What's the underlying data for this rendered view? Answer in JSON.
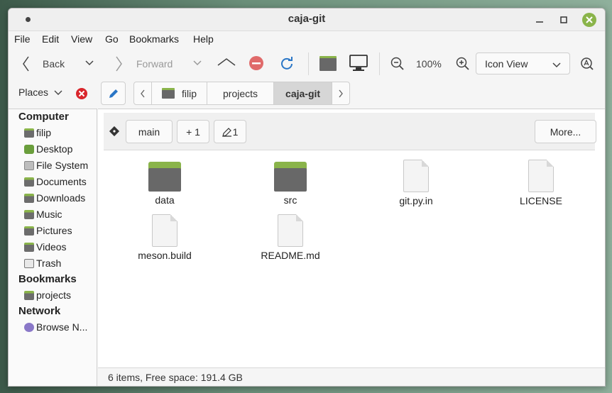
{
  "window": {
    "title": "caja-git"
  },
  "menubar": [
    "File",
    "Edit",
    "View",
    "Go",
    "Bookmarks",
    "Help"
  ],
  "toolbar": {
    "back_label": "Back",
    "forward_label": "Forward",
    "zoom_level": "100%",
    "view_mode": "Icon View"
  },
  "location": {
    "places_label": "Places",
    "breadcrumbs": [
      "filip",
      "projects",
      "caja-git"
    ]
  },
  "git": {
    "branch": "main",
    "added": "+ 1",
    "modified": "1",
    "more_label": "More..."
  },
  "sidebar": {
    "computer_heading": "Computer",
    "computer_items": [
      "filip",
      "Desktop",
      "File System",
      "Documents",
      "Downloads",
      "Music",
      "Pictures",
      "Videos",
      "Trash"
    ],
    "bookmarks_heading": "Bookmarks",
    "bookmark_items": [
      "projects"
    ],
    "network_heading": "Network",
    "network_items": [
      "Browse N..."
    ]
  },
  "files": [
    {
      "name": "data",
      "kind": "folder"
    },
    {
      "name": "src",
      "kind": "folder"
    },
    {
      "name": "git.py.in",
      "kind": "file"
    },
    {
      "name": "LICENSE",
      "kind": "file"
    },
    {
      "name": "meson.build",
      "kind": "file"
    },
    {
      "name": "README.md",
      "kind": "file"
    }
  ],
  "status": {
    "text": "6 items, Free space: 191.4 GB"
  },
  "colors": {
    "accent_green": "#8ab44a",
    "folder_gray": "#686868",
    "stop_red": "#e06a6a",
    "reload_blue": "#2a76c6",
    "delete_red": "#d9262c"
  }
}
